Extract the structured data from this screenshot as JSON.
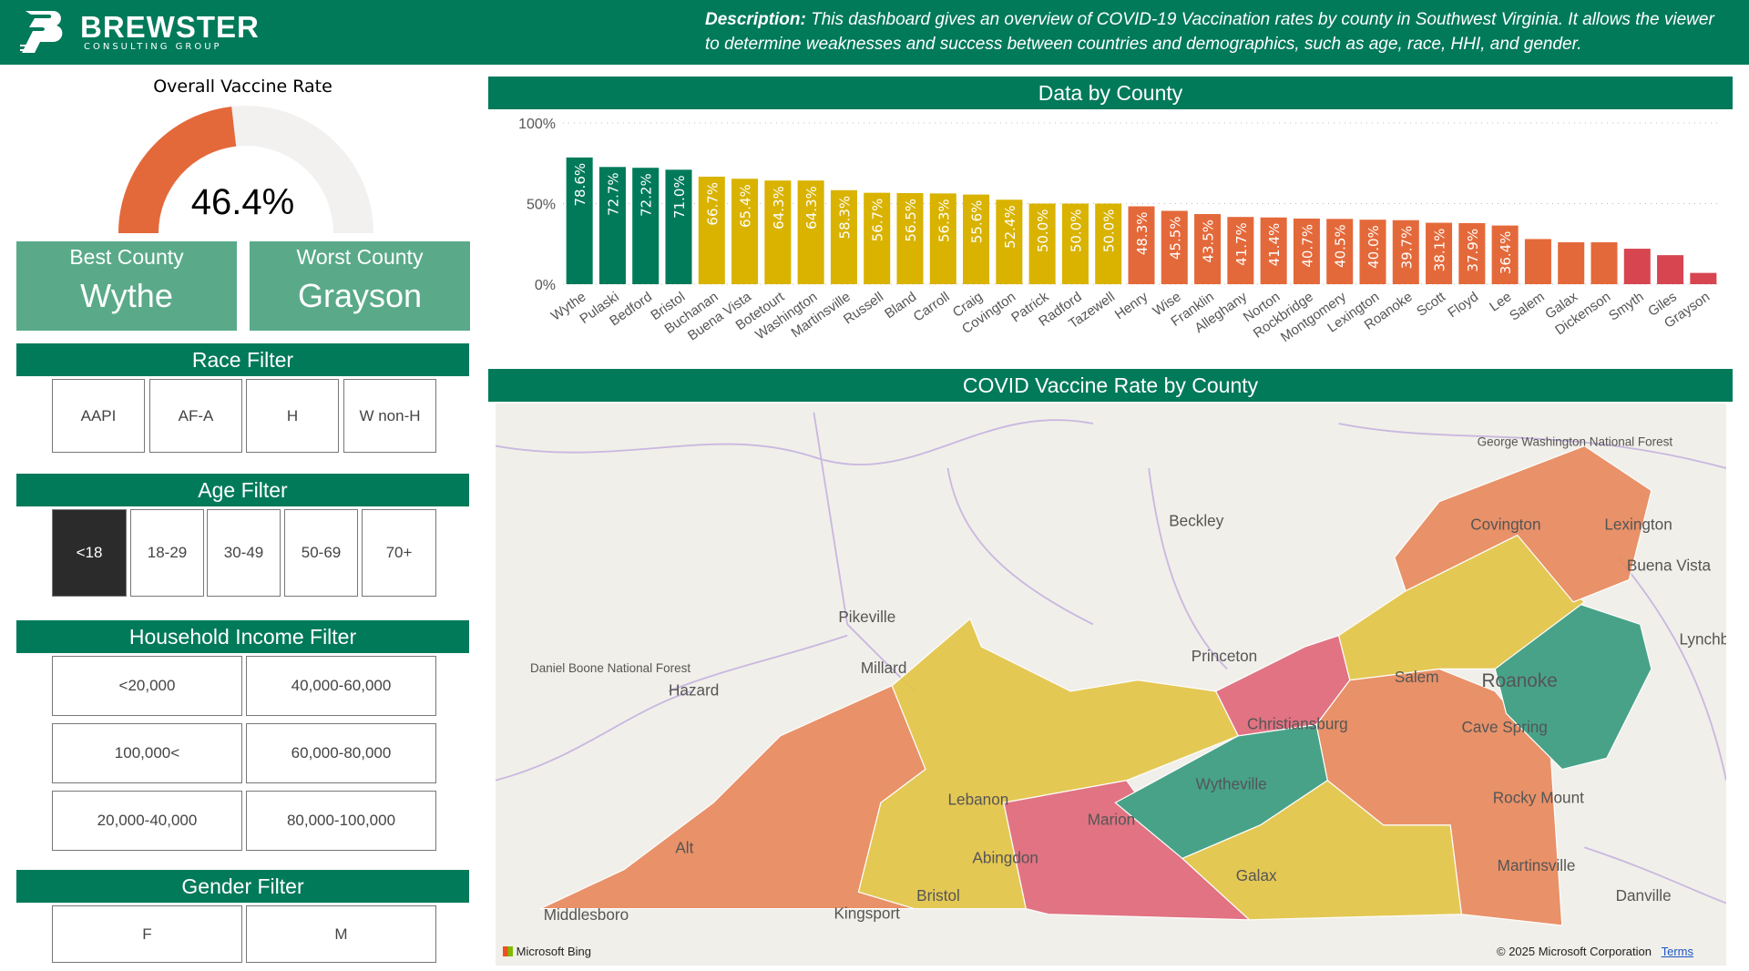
{
  "header": {
    "brand": "BREWSTER",
    "brand_sub": "CONSULTING GROUP",
    "desc_label": "Description:",
    "desc_text": " This dashboard gives an overview of COVID-19 Vaccination rates by county in Southwest Virginia. It allows the viewer to determine weaknesses and success between countries and demographics, such as age, race, HHI, and gender."
  },
  "gauge": {
    "title": "Overall Vaccine Rate",
    "value": "46.4%",
    "fraction": 0.464,
    "fill_color": "#e4693a",
    "track_color": "#f2f1f0"
  },
  "best": {
    "label": "Best County",
    "value": "Wythe"
  },
  "worst": {
    "label": "Worst County",
    "value": "Grayson"
  },
  "race": {
    "title": "Race Filter",
    "options": [
      "AAPI",
      "AF-A",
      "H",
      "W non-H"
    ]
  },
  "age": {
    "title": "Age Filter",
    "options": [
      "<18",
      "18-29",
      "30-49",
      "50-69",
      "70+"
    ],
    "selected": "<18"
  },
  "income": {
    "title": "Household Income Filter",
    "options": [
      "<20,000",
      "40,000-60,000",
      "100,000<",
      "60,000-80,000",
      "20,000-40,000",
      "80,000-100,000"
    ]
  },
  "gender": {
    "title": "Gender Filter",
    "options": [
      "F",
      "M"
    ]
  },
  "chart_title": "Data by County",
  "chart_data": {
    "type": "bar",
    "title": "Data by County",
    "xlabel": "",
    "ylabel": "",
    "ylim": [
      0,
      100
    ],
    "yticks": [
      "0%",
      "50%",
      "100%"
    ],
    "categories": [
      "Wythe",
      "Pulaski",
      "Bedford",
      "Bristol",
      "Buchanan",
      "Buena Vista",
      "Botetourt",
      "Washington",
      "Martinsville",
      "Russell",
      "Bland",
      "Carroll",
      "Craig",
      "Covington",
      "Patrick",
      "Radford",
      "Tazewell",
      "Henry",
      "Wise",
      "Franklin",
      "Alleghany",
      "Norton",
      "Rockbridge",
      "Montgomery",
      "Lexington",
      "Roanoke",
      "Scott",
      "Floyd",
      "Lee",
      "Salem",
      "Galax",
      "Dickenson",
      "Smyth",
      "Giles",
      "Grayson"
    ],
    "values": [
      78.6,
      72.7,
      72.2,
      71.0,
      66.7,
      65.4,
      64.3,
      64.3,
      58.3,
      56.7,
      56.5,
      56.3,
      55.6,
      52.4,
      50.0,
      50.0,
      50.0,
      48.3,
      45.5,
      43.5,
      41.7,
      41.4,
      40.7,
      40.5,
      40.0,
      39.7,
      38.1,
      37.9,
      36.4,
      28,
      26,
      26,
      22,
      18,
      7
    ],
    "labels": [
      "78.6%",
      "72.7%",
      "72.2%",
      "71.0%",
      "66.7%",
      "65.4%",
      "64.3%",
      "64.3%",
      "58.3%",
      "56.7%",
      "56.5%",
      "56.3%",
      "55.6%",
      "52.4%",
      "50.0%",
      "50.0%",
      "50.0%",
      "48.3%",
      "45.5%",
      "43.5%",
      "41.7%",
      "41.4%",
      "40.7%",
      "40.5%",
      "40.0%",
      "39.7%",
      "38.1%",
      "37.9%",
      "36.4%",
      "",
      "",
      "",
      "",
      "",
      ""
    ],
    "colors": {
      "high": "#017a5a",
      "mid": "#d9b300",
      "low": "#e4693a",
      "lowest": "#d64550"
    }
  },
  "map": {
    "title": "COVID Vaccine Rate by County",
    "attribution": "Microsoft Bing",
    "copyright": "© 2025 Microsoft Corporation",
    "terms": "Terms",
    "places": [
      "Beckley",
      "Pikeville",
      "Millard",
      "Hazard",
      "Princeton",
      "Covington",
      "Lexington",
      "Buena Vista",
      "Lynchburg",
      "Salem",
      "Roanoke",
      "Cave Spring",
      "Christiansburg",
      "Wytheville",
      "Marion",
      "Lebanon",
      "Abingdon",
      "Bristol",
      "Kingsport",
      "Galax",
      "Rocky Mount",
      "Martinsville",
      "Danville",
      "Middlesboro",
      "Alt",
      "Daniel Boone National Forest",
      "George Washington National Forest"
    ]
  }
}
